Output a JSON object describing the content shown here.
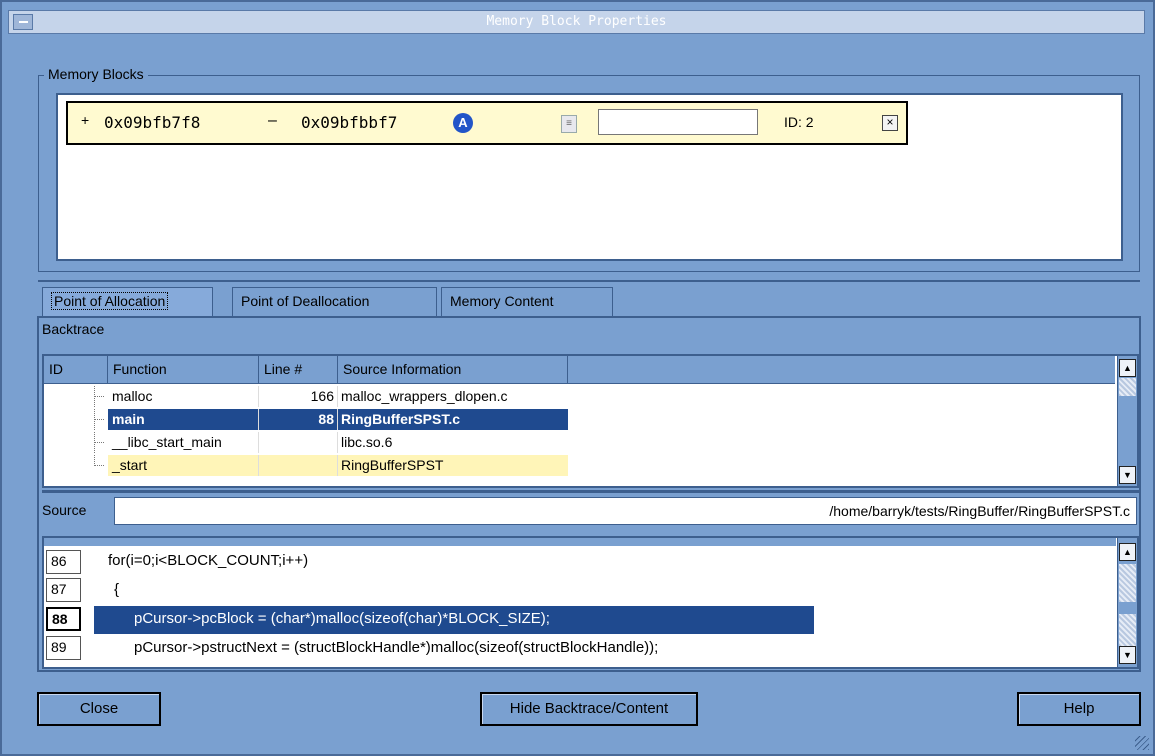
{
  "window": {
    "title": "Memory Block Properties"
  },
  "memory_blocks": {
    "legend": "Memory Blocks",
    "block": {
      "expand_symbol": "+",
      "start_address": "0x09bfb7f8",
      "separator": "–",
      "end_address": "0x09bfbbf7",
      "badge": "A",
      "input_value": "",
      "id_label": "ID: 2",
      "close_symbol": "×"
    }
  },
  "tabs": [
    {
      "label": "Point of Allocation",
      "active": true
    },
    {
      "label": "Point of Deallocation",
      "active": false
    },
    {
      "label": "Memory Content",
      "active": false
    }
  ],
  "backtrace": {
    "label": "Backtrace",
    "columns": [
      "ID",
      "Function",
      "Line #",
      "Source Information"
    ],
    "rows": [
      {
        "function": "malloc",
        "line": "166",
        "source": "malloc_wrappers_dlopen.c",
        "state": "normal"
      },
      {
        "function": "main",
        "line": "88",
        "source": "RingBufferSPST.c",
        "state": "selected"
      },
      {
        "function": "__libc_start_main",
        "line": "",
        "source": "libc.so.6",
        "state": "normal"
      },
      {
        "function": "_start",
        "line": "",
        "source": "RingBufferSPST",
        "state": "highlighted"
      }
    ]
  },
  "source": {
    "label": "Source",
    "path": "/home/barryk/tests/RingBuffer/RingBufferSPST.c",
    "lines": [
      {
        "num": "86",
        "code": "for(i=0;i<BLOCK_COUNT;i++)"
      },
      {
        "num": "87",
        "code": "  {"
      },
      {
        "num": "88",
        "code": "    pCursor->pcBlock = (char*)malloc(sizeof(char)*BLOCK_SIZE);",
        "current": true
      },
      {
        "num": "89",
        "code": "    pCursor->pstructNext = (structBlockHandle*)malloc(sizeof(structBlockHandle));"
      }
    ]
  },
  "buttons": {
    "close": "Close",
    "hide": "Hide Backtrace/Content",
    "help": "Help"
  }
}
